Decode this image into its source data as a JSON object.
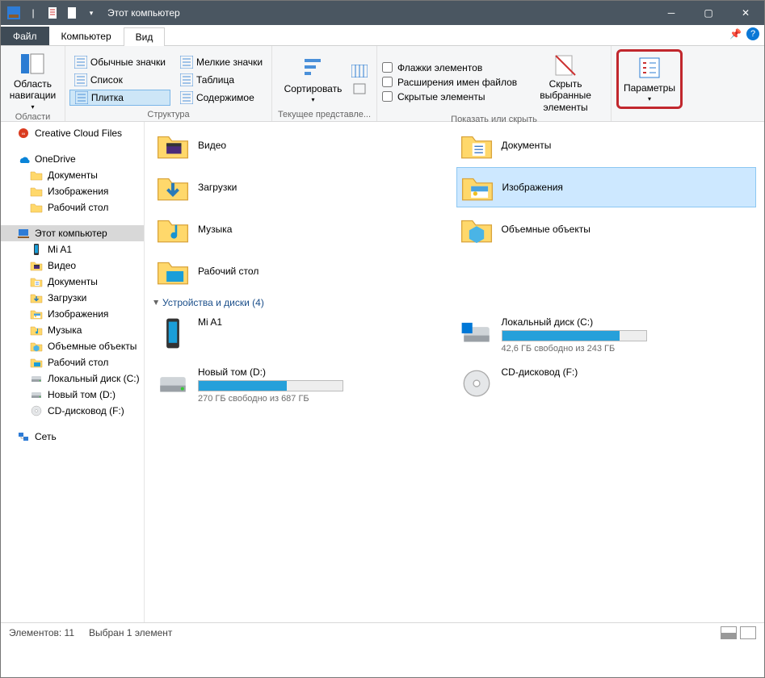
{
  "title": "Этот компьютер",
  "tabs": {
    "file": "Файл",
    "computer": "Компьютер",
    "view": "Вид"
  },
  "ribbon": {
    "areas": {
      "nav": "Область\nнавигации",
      "lbl": "Области"
    },
    "layout": {
      "lbl": "Структура",
      "opts": [
        "Обычные значки",
        "Мелкие значки",
        "Список",
        "Таблица",
        "Плитка",
        "Содержимое"
      ]
    },
    "current": {
      "sort": "Сортировать",
      "lbl": "Текущее представле..."
    },
    "show": {
      "chk1": "Флажки элементов",
      "chk2": "Расширения имен файлов",
      "chk3": "Скрытые элементы",
      "hide": "Скрыть выбранные\nэлементы",
      "lbl": "Показать или скрыть"
    },
    "params": "Параметры"
  },
  "tree": [
    {
      "t": "Creative Cloud Files",
      "ic": "cc"
    },
    {
      "sep": true
    },
    {
      "t": "OneDrive",
      "ic": "od"
    },
    {
      "t": "Документы",
      "ic": "fld",
      "child": true
    },
    {
      "t": "Изображения",
      "ic": "fld",
      "child": true
    },
    {
      "t": "Рабочий стол",
      "ic": "fld",
      "child": true
    },
    {
      "sep": true
    },
    {
      "t": "Этот компьютер",
      "ic": "pc",
      "sel": true
    },
    {
      "t": "Mi A1",
      "ic": "ph",
      "child": true
    },
    {
      "t": "Видео",
      "ic": "vid",
      "child": true
    },
    {
      "t": "Документы",
      "ic": "doc",
      "child": true
    },
    {
      "t": "Загрузки",
      "ic": "dl",
      "child": true
    },
    {
      "t": "Изображения",
      "ic": "img",
      "child": true
    },
    {
      "t": "Музыка",
      "ic": "mus",
      "child": true
    },
    {
      "t": "Объемные объекты",
      "ic": "3d",
      "child": true
    },
    {
      "t": "Рабочий стол",
      "ic": "desk",
      "child": true
    },
    {
      "t": "Локальный диск (С:)",
      "ic": "hdd",
      "child": true
    },
    {
      "t": "Новый том (D:)",
      "ic": "hdd",
      "child": true
    },
    {
      "t": "CD-дисковод (F:)",
      "ic": "cd",
      "child": true
    },
    {
      "sep": true
    },
    {
      "t": "Сеть",
      "ic": "net"
    }
  ],
  "folders": [
    {
      "t": "Видео",
      "ic": "vid"
    },
    {
      "t": "Документы",
      "ic": "doc"
    },
    {
      "t": "Загрузки",
      "ic": "dl"
    },
    {
      "t": "Изображения",
      "ic": "img",
      "sel": true
    },
    {
      "t": "Музыка",
      "ic": "mus"
    },
    {
      "t": "Объемные объекты",
      "ic": "3d"
    },
    {
      "t": "Рабочий стол",
      "ic": "desk"
    }
  ],
  "drives_head": "Устройства и диски (4)",
  "drives": [
    {
      "t": "Mi A1",
      "ic": "ph"
    },
    {
      "t": "Локальный диск (С:)",
      "ic": "win",
      "free": "42,6 ГБ свободно из 243 ГБ",
      "pct": 82
    },
    {
      "t": "Новый том (D:)",
      "ic": "hdd",
      "free": "270 ГБ свободно из 687 ГБ",
      "pct": 61
    },
    {
      "t": "CD-дисковод (F:)",
      "ic": "cd"
    }
  ],
  "status": {
    "count": "Элементов: 11",
    "sel": "Выбран 1 элемент"
  }
}
